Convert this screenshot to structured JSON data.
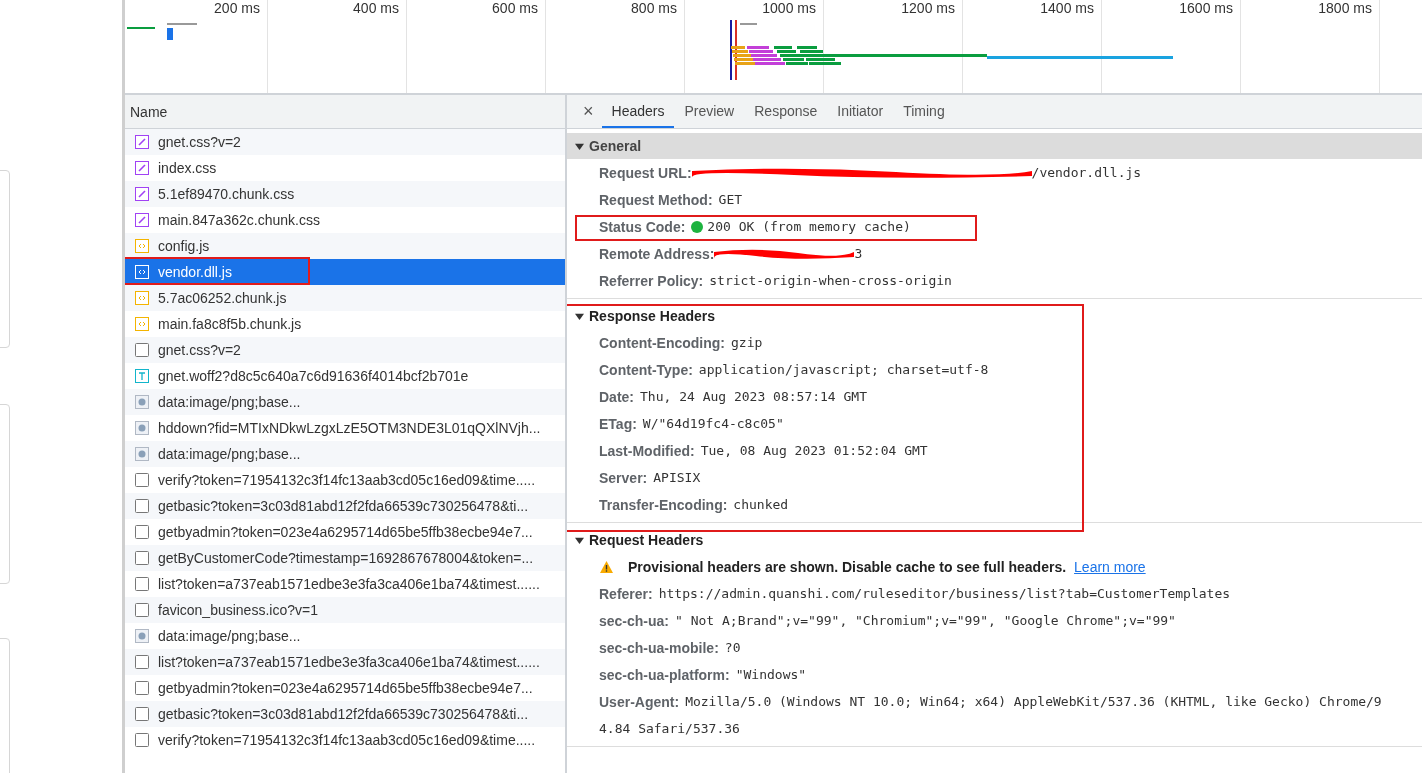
{
  "timeline": {
    "ticks": [
      "200 ms",
      "400 ms",
      "600 ms",
      "800 ms",
      "1000 ms",
      "1200 ms",
      "1400 ms",
      "1600 ms",
      "1800 ms"
    ]
  },
  "requests": {
    "column": "Name",
    "rows": [
      {
        "name": "gnet.css?v=2",
        "kind": "stylesheet",
        "selected": false,
        "highlighted": false
      },
      {
        "name": "index.css",
        "kind": "stylesheet",
        "selected": false,
        "highlighted": false
      },
      {
        "name": "5.1ef89470.chunk.css",
        "kind": "stylesheet",
        "selected": false,
        "highlighted": false
      },
      {
        "name": "main.847a362c.chunk.css",
        "kind": "stylesheet",
        "selected": false,
        "highlighted": false
      },
      {
        "name": "config.js",
        "kind": "script",
        "selected": false,
        "highlighted": false
      },
      {
        "name": "vendor.dll.js",
        "kind": "script",
        "selected": true,
        "highlighted": true
      },
      {
        "name": "5.7ac06252.chunk.js",
        "kind": "script",
        "selected": false,
        "highlighted": false
      },
      {
        "name": "main.fa8c8f5b.chunk.js",
        "kind": "script",
        "selected": false,
        "highlighted": false
      },
      {
        "name": "gnet.css?v=2",
        "kind": "document",
        "selected": false,
        "highlighted": false
      },
      {
        "name": "gnet.woff2?d8c5c640a7c6d91636f4014bcf2b701e",
        "kind": "font",
        "selected": false,
        "highlighted": false
      },
      {
        "name": "data:image/png;base...",
        "kind": "image",
        "selected": false,
        "highlighted": false
      },
      {
        "name": "hddown?fid=MTIxNDkwLzgxLzE5OTM3NDE3L01qQXlNVjh...",
        "kind": "image",
        "selected": false,
        "highlighted": false
      },
      {
        "name": "data:image/png;base...",
        "kind": "image",
        "selected": false,
        "highlighted": false
      },
      {
        "name": "verify?token=71954132c3f14fc13aab3cd05c16ed09&time.....",
        "kind": "document",
        "selected": false,
        "highlighted": false
      },
      {
        "name": "getbasic?token=3c03d81abd12f2fda66539c730256478&ti...",
        "kind": "document",
        "selected": false,
        "highlighted": false
      },
      {
        "name": "getbyadmin?token=023e4a6295714d65be5ffb38ecbe94e7...",
        "kind": "document",
        "selected": false,
        "highlighted": false
      },
      {
        "name": "getByCustomerCode?timestamp=1692867678004&token=...",
        "kind": "document",
        "selected": false,
        "highlighted": false
      },
      {
        "name": "list?token=a737eab1571edbe3e3fa3ca406e1ba74&timest......",
        "kind": "document",
        "selected": false,
        "highlighted": false
      },
      {
        "name": "favicon_business.ico?v=1",
        "kind": "document",
        "selected": false,
        "highlighted": false
      },
      {
        "name": "data:image/png;base...",
        "kind": "image",
        "selected": false,
        "highlighted": false
      },
      {
        "name": "list?token=a737eab1571edbe3e3fa3ca406e1ba74&timest......",
        "kind": "document",
        "selected": false,
        "highlighted": false
      },
      {
        "name": "getbyadmin?token=023e4a6295714d65be5ffb38ecbe94e7...",
        "kind": "document",
        "selected": false,
        "highlighted": false
      },
      {
        "name": "getbasic?token=3c03d81abd12f2fda66539c730256478&ti...",
        "kind": "document",
        "selected": false,
        "highlighted": false
      },
      {
        "name": "verify?token=71954132c3f14fc13aab3cd05c16ed09&time.....",
        "kind": "document",
        "selected": false,
        "highlighted": false
      }
    ]
  },
  "details": {
    "close": "×",
    "tabs": [
      {
        "label": "Headers",
        "selected": true
      },
      {
        "label": "Preview",
        "selected": false
      },
      {
        "label": "Response",
        "selected": false
      },
      {
        "label": "Initiator",
        "selected": false
      },
      {
        "label": "Timing",
        "selected": false
      }
    ],
    "sections": [
      {
        "title": "General",
        "expanded": true,
        "shaded": true,
        "highlighted": false,
        "rows": [
          {
            "kind": "redacted",
            "key": "Request URL:",
            "value": "/vendor.dll.js",
            "highlighted": false
          },
          {
            "kind": "text",
            "key": "Request Method:",
            "value": "GET",
            "highlighted": false
          },
          {
            "kind": "status",
            "key": "Status Code:",
            "value": "200 OK (from memory cache)",
            "highlighted": true
          },
          {
            "kind": "redacted",
            "key": "Remote Address:",
            "value": "3",
            "highlighted": false
          },
          {
            "kind": "text",
            "key": "Referrer Policy:",
            "value": "strict-origin-when-cross-origin",
            "highlighted": false
          }
        ]
      },
      {
        "title": "Response Headers",
        "expanded": true,
        "shaded": false,
        "highlighted": true,
        "rows": [
          {
            "kind": "text",
            "key": "Content-Encoding:",
            "value": "gzip",
            "highlighted": false
          },
          {
            "kind": "text",
            "key": "Content-Type:",
            "value": "application/javascript; charset=utf-8",
            "highlighted": false
          },
          {
            "kind": "text",
            "key": "Date:",
            "value": "Thu, 24 Aug 2023 08:57:14 GMT",
            "highlighted": false
          },
          {
            "kind": "text",
            "key": "ETag:",
            "value": "W/\"64d19fc4-c8c05\"",
            "highlighted": false
          },
          {
            "kind": "text",
            "key": "Last-Modified:",
            "value": "Tue, 08 Aug 2023 01:52:04 GMT",
            "highlighted": false
          },
          {
            "kind": "text",
            "key": "Server:",
            "value": "APISIX",
            "highlighted": false
          },
          {
            "kind": "text",
            "key": "Transfer-Encoding:",
            "value": "chunked",
            "highlighted": false
          }
        ]
      },
      {
        "title": "Request Headers",
        "expanded": true,
        "shaded": false,
        "highlighted": false,
        "rows": [
          {
            "kind": "warning",
            "value": "Provisional headers are shown. Disable cache to see full headers.",
            "link": "Learn more",
            "highlighted": false
          },
          {
            "kind": "text",
            "key": "Referer:",
            "value": "https://admin.quanshi.com/ruleseditor/business/list?tab=CustomerTemplates",
            "highlighted": false
          },
          {
            "kind": "text",
            "key": "sec-ch-ua:",
            "value": "\" Not A;Brand\";v=\"99\", \"Chromium\";v=\"99\", \"Google Chrome\";v=\"99\"",
            "highlighted": false
          },
          {
            "kind": "text",
            "key": "sec-ch-ua-mobile:",
            "value": "?0",
            "highlighted": false
          },
          {
            "kind": "text",
            "key": "sec-ch-ua-platform:",
            "value": "\"Windows\"",
            "highlighted": false
          },
          {
            "kind": "text",
            "key": "User-Agent:",
            "value": "Mozilla/5.0 (Windows NT 10.0; Win64; x64) AppleWebKit/537.36 (KHTML, like Gecko) Chrome/9",
            "continuation": "4.84 Safari/537.36",
            "highlighted": false
          }
        ]
      }
    ]
  }
}
